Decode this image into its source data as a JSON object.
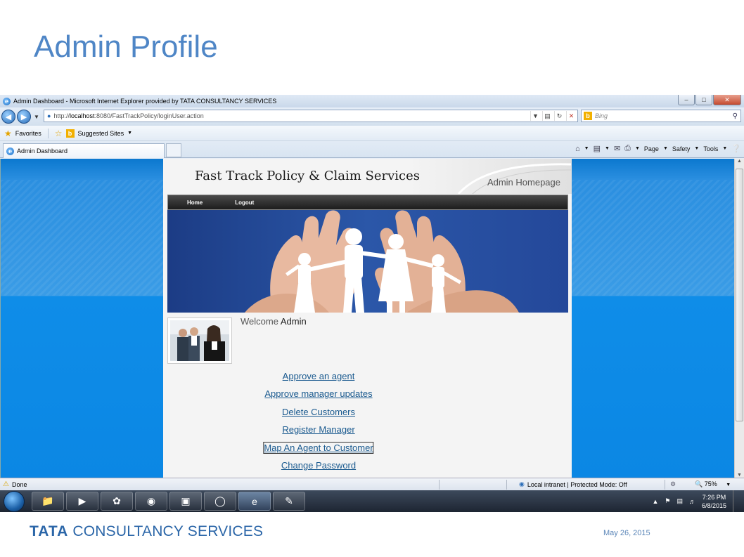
{
  "slide": {
    "title": "Admin Profile",
    "footer_brand_bold": "TATA",
    "footer_brand_rest": "CONSULTANCY SERVICES",
    "date": "May 26, 2015"
  },
  "browser": {
    "window_title": "Admin Dashboard - Microsoft Internet Explorer provided by TATA CONSULTANCY SERVICES",
    "url_prefix": "http://",
    "url_host": "localhost",
    "url_rest": ":8080/FastTrackPolicy/loginUser.action",
    "search_placeholder": "Bing",
    "favorites_label": "Favorites",
    "suggested_sites_label": "Suggested Sites",
    "tab_label": "Admin Dashboard",
    "command_bar": {
      "page": "Page",
      "safety": "Safety",
      "tools": "Tools"
    },
    "status": {
      "text": "Done",
      "zone": "Local intranet | Protected Mode: Off",
      "zoom": "75%"
    }
  },
  "webpage": {
    "brand": "Fast Track Policy & Claim Services",
    "subtitle": "Admin Homepage",
    "menu": [
      "Home",
      "Logout"
    ],
    "welcome_prefix": "Welcome",
    "welcome_user": "Admin",
    "links": [
      "Approve an agent",
      "Approve manager updates",
      "Delete Customers",
      "Register Manager",
      "Map An Agent to Customer",
      "Change Password"
    ]
  },
  "taskbar": {
    "time": "7:26 PM",
    "date": "6/8/2015"
  },
  "colors": {
    "slide_title": "#4f86c6",
    "page_background": "#0b87e4",
    "link": "#1a5a8f",
    "footer_brand": "#2b66a8"
  }
}
